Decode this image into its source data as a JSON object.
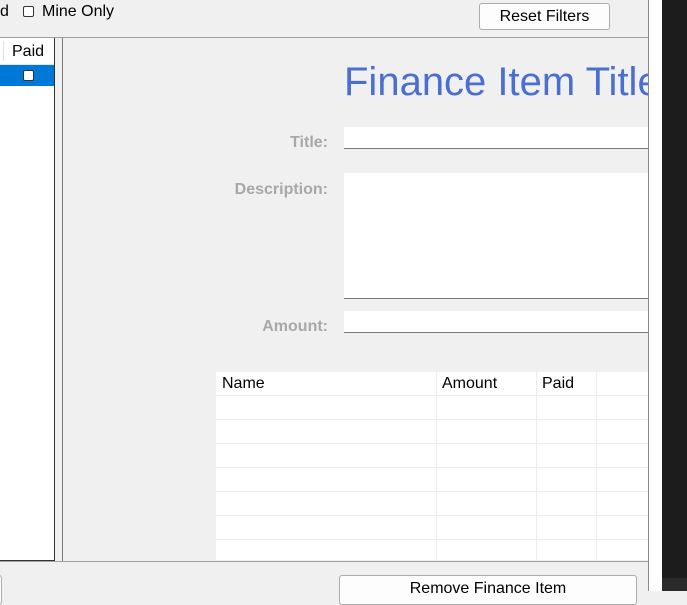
{
  "filters": {
    "partial_label": "d",
    "mine_only_label": "Mine Only",
    "mine_only_checked": false,
    "reset_button": "Reset Filters"
  },
  "list": {
    "header": "Paid",
    "rows": [
      {
        "selected": true,
        "paid": false
      }
    ]
  },
  "detail": {
    "title_heading": "Finance Item Title",
    "fields": {
      "title_label": "Title:",
      "title_value": "",
      "description_label": "Description:",
      "description_value": "",
      "amount_label": "Amount:",
      "amount_value": ""
    },
    "grid": {
      "columns": [
        "Name",
        "Amount",
        "Paid"
      ],
      "rows": [
        [],
        [],
        [],
        [],
        [],
        [],
        []
      ]
    }
  },
  "footer": {
    "remove_button": "Remove Finance Item"
  }
}
